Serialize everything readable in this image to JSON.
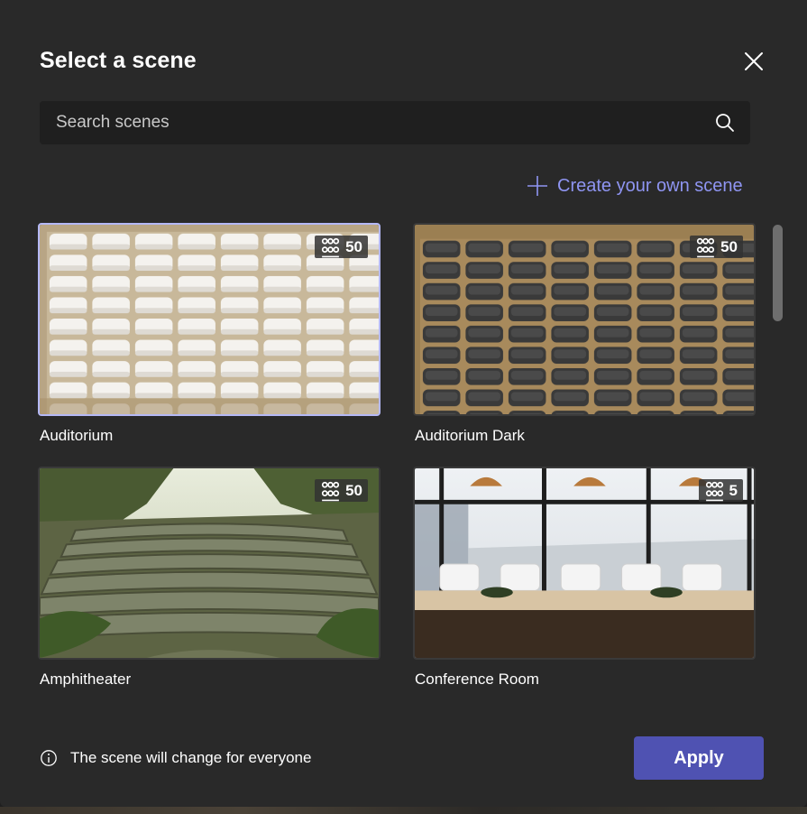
{
  "dialog": {
    "title": "Select a scene",
    "close_icon": "close-icon"
  },
  "search": {
    "placeholder": "Search scenes",
    "value": "",
    "icon": "search-icon"
  },
  "create_link": {
    "label": "Create your own scene",
    "icon": "plus-icon"
  },
  "scenes": [
    {
      "name": "Auditorium",
      "capacity": "50",
      "selected": true,
      "style": "white-seats"
    },
    {
      "name": "Auditorium Dark",
      "capacity": "50",
      "selected": false,
      "style": "dark-seats"
    },
    {
      "name": "Amphitheater",
      "capacity": "50",
      "selected": false,
      "style": "stone-steps"
    },
    {
      "name": "Conference Room",
      "capacity": "5",
      "selected": false,
      "style": "conference-room"
    }
  ],
  "footer": {
    "info_icon": "info-icon",
    "info_text": "The scene will change for everyone",
    "apply_label": "Apply"
  },
  "colors": {
    "dialog_bg": "#292929",
    "accent": "#4f52b2",
    "link": "#8f95f2",
    "selected_border": "#b4b8f6"
  }
}
